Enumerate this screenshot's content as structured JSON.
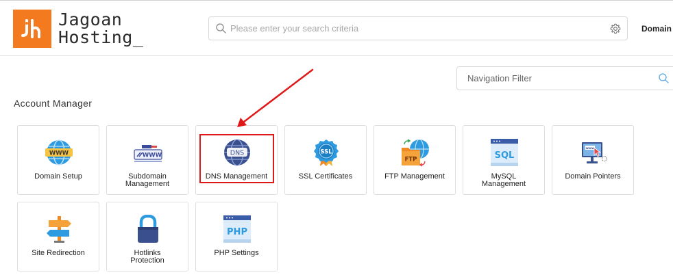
{
  "header": {
    "logo_line1": "Jagoan",
    "logo_line2": "Hosting_",
    "search_placeholder": "Please enter your search criteria",
    "domain_label": "Domain"
  },
  "nav_filter": {
    "placeholder": "Navigation Filter"
  },
  "section": {
    "title": "Account Manager"
  },
  "tiles": [
    {
      "label_line1": "Domain Setup",
      "label_line2": "",
      "icon": "globe-www-icon"
    },
    {
      "label_line1": "Subdomain",
      "label_line2": "Management",
      "icon": "subdomain-www-icon"
    },
    {
      "label_line1": "DNS Management",
      "label_line2": "",
      "icon": "dns-globe-icon"
    },
    {
      "label_line1": "SSL Certificates",
      "label_line2": "",
      "icon": "ssl-badge-icon"
    },
    {
      "label_line1": "FTP Management",
      "label_line2": "",
      "icon": "ftp-folder-icon"
    },
    {
      "label_line1": "MySQL",
      "label_line2": "Management",
      "icon": "sql-database-icon"
    },
    {
      "label_line1": "Domain Pointers",
      "label_line2": "",
      "icon": "domain-pointer-monitor-icon"
    },
    {
      "label_line1": "Site Redirection",
      "label_line2": "",
      "icon": "signpost-icon"
    },
    {
      "label_line1": "Hotlinks",
      "label_line2": "Protection",
      "icon": "padlock-icon"
    },
    {
      "label_line1": "PHP Settings",
      "label_line2": "",
      "icon": "php-window-icon"
    }
  ],
  "icon_text": {
    "www": "WWW",
    "dns": "DNS",
    "ssl": "SSL",
    "ftp": "FTP",
    "sql": "SQL",
    "php": "PHP"
  },
  "colors": {
    "brand_orange": "#f37a1f",
    "highlight_red": "#e01818"
  }
}
